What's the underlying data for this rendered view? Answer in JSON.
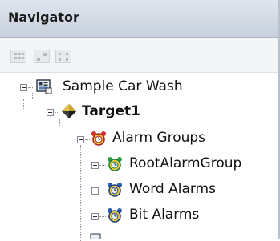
{
  "panel": {
    "title": "Navigator"
  },
  "toolbar": {
    "buttons": [
      "grid-view-icon",
      "expand-view-icon",
      "collapse-view-icon"
    ]
  },
  "tree": {
    "root": {
      "label": "Sample Car Wash",
      "icon": "project-icon",
      "expanded": true
    },
    "target": {
      "label": "Target1",
      "icon": "target-diamond-icon",
      "expanded": true
    },
    "alarm_groups": {
      "label": "Alarm Groups",
      "icon": "alarm-clock-icon",
      "expanded": true
    },
    "children": [
      {
        "label": "RootAlarmGroup",
        "icon": "alarm-group-icon",
        "expanded": false
      },
      {
        "label": "Word Alarms",
        "icon": "alarm-group-icon",
        "expanded": false
      },
      {
        "label": "Bit Alarms",
        "icon": "alarm-group-icon",
        "expanded": false
      }
    ]
  },
  "colors": {
    "header_bg": "#d3dae4",
    "alarm_red": "#d0312d",
    "alarm_green": "#2e9d4a",
    "alarm_blue": "#2a5fb0"
  }
}
